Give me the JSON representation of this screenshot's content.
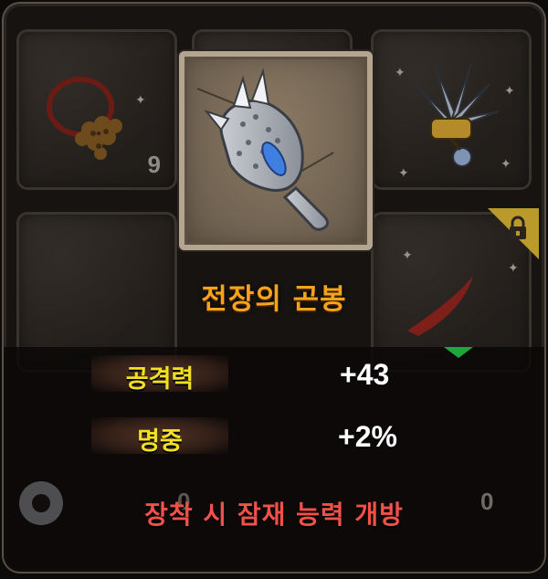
{
  "item": {
    "name": "전장의 곤봉",
    "icon": "spiked-club-icon",
    "rarity_color": "#b3a58f"
  },
  "stats": [
    {
      "label": "공격력",
      "value": "+43"
    },
    {
      "label": "명중",
      "value": "+2%"
    }
  ],
  "effect_text": "장착 시 잠재 능력 개방",
  "slots": {
    "top_left": {
      "icon": "pendant-icon",
      "count": "9"
    },
    "top_right": {
      "icon": "feather-crest-icon",
      "count": ""
    },
    "mid_right": {
      "icon": "red-feather-icon",
      "locked": true
    },
    "bottom_left_count": "0",
    "bottom_right_count": "0"
  },
  "colors": {
    "name": "#f6a31c",
    "stat_label": "#f3e020",
    "stat_value": "#ffffff",
    "effect": "#f2514a"
  }
}
